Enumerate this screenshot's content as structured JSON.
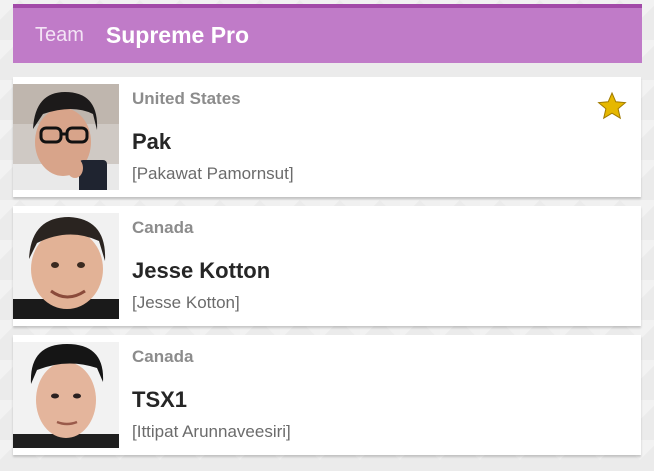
{
  "header": {
    "label": "Team",
    "team_name": "Supreme Pro"
  },
  "players": [
    {
      "country": "United States",
      "nickname": "Pak",
      "real_name": "[Pakawat Pamornsut]",
      "favorite": true,
      "icon": "star-icon"
    },
    {
      "country": "Canada",
      "nickname": "Jesse Kotton",
      "real_name": "[Jesse Kotton]",
      "favorite": false
    },
    {
      "country": "Canada",
      "nickname": "TSX1",
      "real_name": "[Ittipat Arunnaveesiri]",
      "favorite": false
    }
  ],
  "colors": {
    "header_bg": "#c07bc8",
    "header_border": "#a24aa8",
    "star": "#e6b800"
  }
}
